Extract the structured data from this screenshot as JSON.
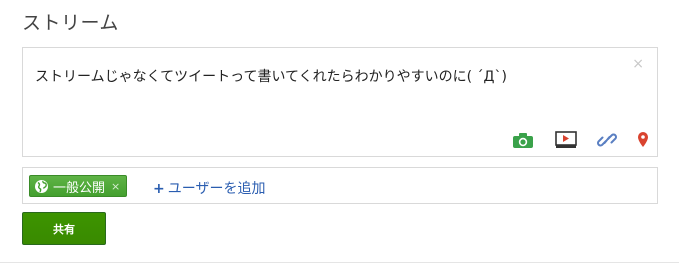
{
  "header": {
    "title": "ストリーム"
  },
  "composer": {
    "text": "ストリームじゃなくてツイートって書いてくれたらわかりやすいのに( ´Д`)",
    "close_symbol": "×",
    "attachments": [
      {
        "name": "photo",
        "icon": "camera-icon",
        "color": "#3aa24a"
      },
      {
        "name": "video",
        "icon": "video-icon",
        "color": "#333333"
      },
      {
        "name": "link",
        "icon": "link-icon",
        "color": "#5a7fc2"
      },
      {
        "name": "location",
        "icon": "map-pin-icon",
        "color": "#d9432f"
      }
    ]
  },
  "share": {
    "chip_label": "一般公開",
    "chip_remove": "×",
    "add_people": "ユーザーを追加",
    "add_plus": "+",
    "button_label": "共有"
  },
  "colors": {
    "accent_green": "#3d9400",
    "link_blue": "#2a5db0",
    "border": "#d9d9d9"
  }
}
